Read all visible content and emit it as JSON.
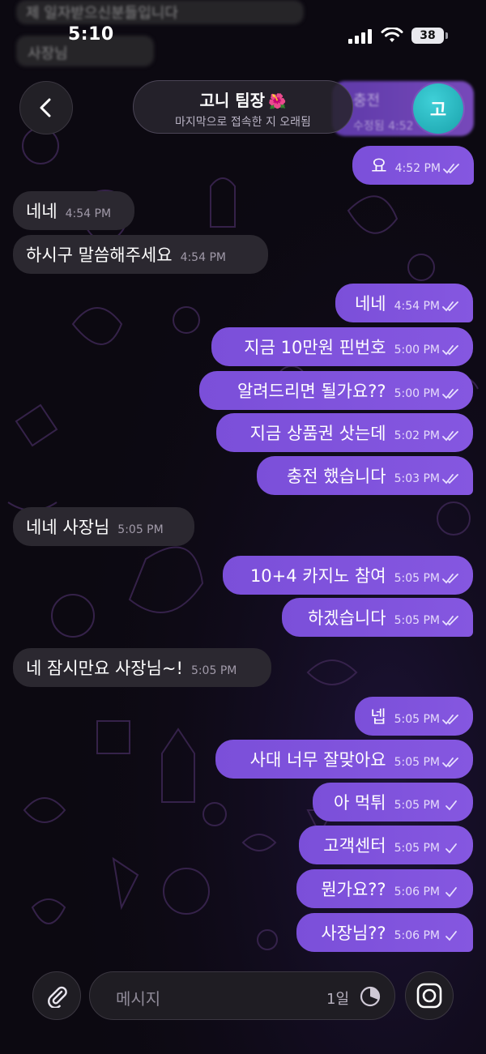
{
  "status_bar": {
    "time": "5:10",
    "battery": "38"
  },
  "blurred_top": {
    "line1": "제 일자받으신분들입니다",
    "line2": "사장님"
  },
  "header": {
    "title": "고니 팀장",
    "subtitle": "마지막으로 접속한 지 오래됨",
    "avatar_letter": "고",
    "peek_text": "충전",
    "peek_sub": "수정됨 4:52",
    "accent_flower": "🌺"
  },
  "messages": [
    {
      "dir": "out",
      "text": "요",
      "time": "4:52 PM",
      "status": "read"
    },
    {
      "dir": "in",
      "text": "네네",
      "time": "4:54 PM"
    },
    {
      "dir": "in",
      "text": "하시구 말씀해주세요",
      "time": "4:54 PM"
    },
    {
      "dir": "out",
      "text": "네네",
      "time": "4:54 PM",
      "status": "read"
    },
    {
      "dir": "out",
      "text": "지금 10만원 핀번호",
      "time": "5:00 PM",
      "status": "read"
    },
    {
      "dir": "out",
      "text": "알려드리면 될가요??",
      "time": "5:00 PM",
      "status": "read"
    },
    {
      "dir": "out",
      "text": "지금 상품권 삿는데",
      "time": "5:02 PM",
      "status": "read"
    },
    {
      "dir": "out",
      "text": "충전 했습니다",
      "time": "5:03 PM",
      "status": "read"
    },
    {
      "dir": "in",
      "text": "네네 사장님",
      "time": "5:05 PM"
    },
    {
      "dir": "out",
      "text": "10+4 카지노 참여",
      "time": "5:05 PM",
      "status": "read"
    },
    {
      "dir": "out",
      "text": "하겠습니다",
      "time": "5:05 PM",
      "status": "read"
    },
    {
      "dir": "in",
      "text": "네 잠시만요 사장님~!",
      "time": "5:05 PM"
    },
    {
      "dir": "out",
      "text": "넵",
      "time": "5:05 PM",
      "status": "read"
    },
    {
      "dir": "out",
      "text": "사대 너무 잘맞아요",
      "time": "5:05 PM",
      "status": "read"
    },
    {
      "dir": "out",
      "text": "아 먹튀",
      "time": "5:05 PM",
      "status": "sent"
    },
    {
      "dir": "out",
      "text": "고객센터",
      "time": "5:05 PM",
      "status": "sent"
    },
    {
      "dir": "out",
      "text": "뭔가요??",
      "time": "5:06 PM",
      "status": "sent"
    },
    {
      "dir": "out",
      "text": "사장님??",
      "time": "5:06 PM",
      "status": "sent"
    }
  ],
  "composer": {
    "placeholder": "메시지",
    "timer_label": "1일"
  },
  "colors": {
    "outgoing_start": "#7b4fd9",
    "outgoing_end": "#8557e0",
    "incoming": "#2b2830",
    "avatar": "#1aa2ab"
  }
}
